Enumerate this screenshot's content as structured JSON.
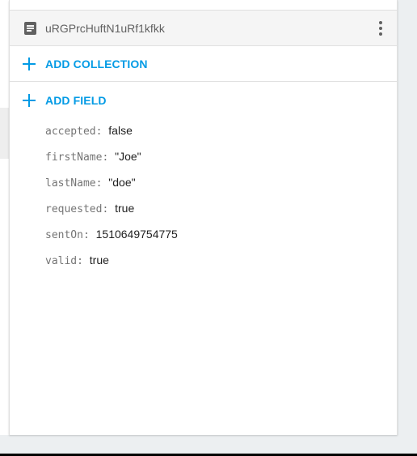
{
  "document": {
    "title": "uRGPrcHuftN1uRf1kfkk",
    "icon": "document-icon",
    "menu_icon": "more-vert-icon"
  },
  "actions": {
    "add_collection_label": "ADD COLLECTION",
    "add_field_label": "ADD FIELD",
    "icon": "plus-icon"
  },
  "fields": [
    {
      "key": "accepted",
      "value": "false"
    },
    {
      "key": "firstName",
      "value": "\"Joe\""
    },
    {
      "key": "lastName",
      "value": "\"doe\""
    },
    {
      "key": "requested",
      "value": "true"
    },
    {
      "key": "sentOn",
      "value": "1510649754775"
    },
    {
      "key": "valid",
      "value": "true"
    }
  ],
  "colors": {
    "accent": "#039be5",
    "header_bg": "#f5f5f5",
    "page_bg": "#eceff1"
  }
}
